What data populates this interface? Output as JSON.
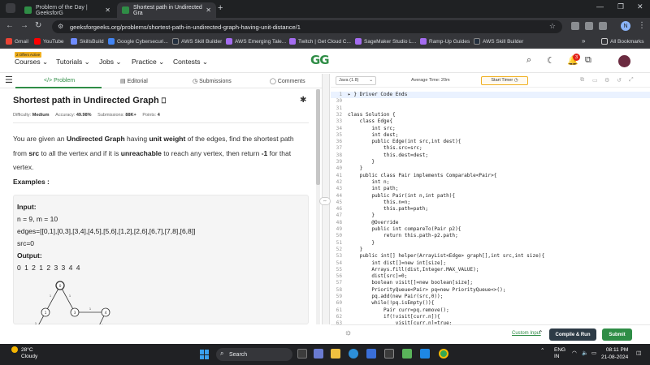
{
  "browser": {
    "tabs": [
      {
        "title": "Problem of the Day | GeeksforG",
        "active": false
      },
      {
        "title": "Shortest path in Undirected Gra",
        "active": true
      }
    ],
    "new_tab": "+",
    "url": "geeksforgeeks.org/problems/shortest-path-in-undirected-graph-having-unit-distance/1",
    "profile_initial": "N",
    "bookmarks": [
      "Gmail",
      "YouTube",
      "SkillsBuild",
      "Google Cybersecuri...",
      "AWS Skill Builder",
      "AWS Emerging Tale...",
      "Twitch | Get Cloud C...",
      "SageMaker Studio L...",
      "Ramp-Up Guides",
      "AWS Skill Builder"
    ],
    "more_bookmarks": "»",
    "all_bookmarks": "All Bookmarks"
  },
  "site": {
    "offer_badge": "2 Offers Active",
    "menu": [
      "Courses",
      "Tutorials",
      "Jobs",
      "Practice",
      "Contests"
    ],
    "logo": "GG",
    "notification_count": "3",
    "colors": {
      "brand": "#2f8d46",
      "notification": "#e2231a"
    }
  },
  "problem": {
    "tabs": [
      "</> Problem",
      "Editorial",
      "Submissions",
      "Comments"
    ],
    "title": "Shortest path in Undirected Graph",
    "difficulty_label": "Difficulty:",
    "difficulty": "Medium",
    "accuracy_label": "Accuracy:",
    "accuracy": "49.98%",
    "submissions_label": "Submissions:",
    "submissions": "88K+",
    "points_label": "Points:",
    "points": "4",
    "desc": {
      "p1": "You are given an ",
      "b1": "Undirected Graph",
      "p2": " having ",
      "b2": "unit weight",
      "p3": " of the edges, find the shortest path from ",
      "b3": "src",
      "p4": " to all the vertex and if it is ",
      "b4": "unreachable",
      "p5": " to reach any vertex, then return ",
      "b5": "-1",
      "p6": " for that vertex."
    },
    "examples_heading": "Examples :",
    "example": {
      "input_label": "Input:",
      "n_m": "n = 9, m = 10",
      "edges": "edges=[[0,1],[0,3],[3,4],[4,5],[5,6],[1,2],[2,6],[6,7],[7,8],[6,8]]",
      "src": "src=0",
      "output_label": "Output:",
      "output": "0 1 2 1 2 3 3 4 4"
    },
    "graph_nodes": [
      "0",
      "1",
      "3",
      "4",
      "2",
      "5"
    ],
    "graph_edge_labels": [
      "1",
      "1",
      "1",
      "1",
      "1",
      "1",
      "1"
    ]
  },
  "editor": {
    "language": "Java (1.8)",
    "avg_time": "Average Time: 20m",
    "timer_label": "Start Timer",
    "lines": [
      {
        "n": "1",
        "t": "▸ } Driver Code Ends",
        "hl": true
      },
      {
        "n": "30",
        "t": ""
      },
      {
        "n": "31",
        "t": ""
      },
      {
        "n": "32",
        "t": "class Solution {"
      },
      {
        "n": "33",
        "t": "    class Edge{"
      },
      {
        "n": "34",
        "t": "        int src;"
      },
      {
        "n": "35",
        "t": "        int dest;"
      },
      {
        "n": "36",
        "t": "        public Edge(int src,int dest){"
      },
      {
        "n": "37",
        "t": "            this.src=src;"
      },
      {
        "n": "38",
        "t": "            this.dest=dest;"
      },
      {
        "n": "39",
        "t": "        }"
      },
      {
        "n": "40",
        "t": "    }"
      },
      {
        "n": "41",
        "t": "    public class Pair implements Comparable<Pair>{"
      },
      {
        "n": "42",
        "t": "        int n;"
      },
      {
        "n": "43",
        "t": "        int path;"
      },
      {
        "n": "44",
        "t": "        public Pair(int n,int path){"
      },
      {
        "n": "45",
        "t": "            this.n=n;"
      },
      {
        "n": "46",
        "t": "            this.path=path;"
      },
      {
        "n": "47",
        "t": "        }"
      },
      {
        "n": "48",
        "t": "        @Override"
      },
      {
        "n": "49",
        "t": "        public int compareTo(Pair p2){"
      },
      {
        "n": "50",
        "t": "            return this.path-p2.path;"
      },
      {
        "n": "51",
        "t": "        }"
      },
      {
        "n": "52",
        "t": "    }"
      },
      {
        "n": "53",
        "t": "    public int[] helper(ArrayList<Edge> graph[],int src,int size){"
      },
      {
        "n": "54",
        "t": "        int dist[]=new int[size];"
      },
      {
        "n": "55",
        "t": "        Arrays.fill(dist,Integer.MAX_VALUE);"
      },
      {
        "n": "56",
        "t": "        dist[src]=0;"
      },
      {
        "n": "57",
        "t": "        boolean visit[]=new boolean[size];"
      },
      {
        "n": "58",
        "t": "        PriorityQueue<Pair> pq=new PriorityQueue<>();"
      },
      {
        "n": "59",
        "t": "        pq.add(new Pair(src,0));"
      },
      {
        "n": "60",
        "t": "        while(!pq.isEmpty()){"
      },
      {
        "n": "61",
        "t": "            Pair curr=pq.remove();"
      },
      {
        "n": "62",
        "t": "            if(!visit[curr.n]){"
      },
      {
        "n": "63",
        "t": "                visit[curr.n]=true;"
      }
    ],
    "custom_input": "Custom Input",
    "run_label": "Compile & Run",
    "submit_label": "Submit"
  },
  "taskbar": {
    "temperature": "28°C",
    "weather": "Cloudy",
    "search_placeholder": "Search",
    "lang": "ENG",
    "region": "IN",
    "time": "08:11 PM",
    "date": "21-08-2024"
  }
}
